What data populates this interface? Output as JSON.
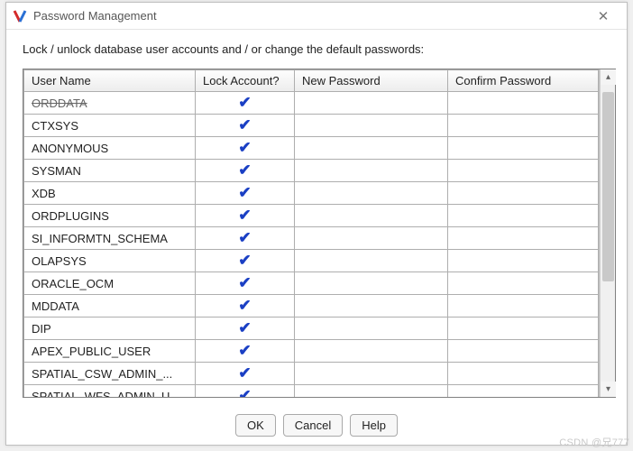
{
  "window": {
    "title": "Password Management",
    "close_glyph": "✕"
  },
  "instruction": "Lock / unlock database user accounts and / or change the default passwords:",
  "columns": {
    "user": "User Name",
    "lock": "Lock Account?",
    "newpw": "New Password",
    "confpw": "Confirm Password"
  },
  "rows": [
    {
      "user": "ORDDATA",
      "locked": true,
      "newpw": "",
      "confpw": ""
    },
    {
      "user": "CTXSYS",
      "locked": true,
      "newpw": "",
      "confpw": ""
    },
    {
      "user": "ANONYMOUS",
      "locked": true,
      "newpw": "",
      "confpw": ""
    },
    {
      "user": "SYSMAN",
      "locked": true,
      "newpw": "",
      "confpw": ""
    },
    {
      "user": "XDB",
      "locked": true,
      "newpw": "",
      "confpw": ""
    },
    {
      "user": "ORDPLUGINS",
      "locked": true,
      "newpw": "",
      "confpw": ""
    },
    {
      "user": "SI_INFORMTN_SCHEMA",
      "locked": true,
      "newpw": "",
      "confpw": ""
    },
    {
      "user": "OLAPSYS",
      "locked": true,
      "newpw": "",
      "confpw": ""
    },
    {
      "user": "ORACLE_OCM",
      "locked": true,
      "newpw": "",
      "confpw": ""
    },
    {
      "user": "MDDATA",
      "locked": true,
      "newpw": "",
      "confpw": ""
    },
    {
      "user": "DIP",
      "locked": true,
      "newpw": "",
      "confpw": ""
    },
    {
      "user": "APEX_PUBLIC_USER",
      "locked": true,
      "newpw": "",
      "confpw": ""
    },
    {
      "user": "SPATIAL_CSW_ADMIN_...",
      "locked": true,
      "newpw": "",
      "confpw": ""
    },
    {
      "user": "SPATIAL_WFS_ADMIN_U...",
      "locked": true,
      "newpw": "",
      "confpw": ""
    }
  ],
  "buttons": {
    "ok": "OK",
    "cancel": "Cancel",
    "help": "Help"
  },
  "scroll": {
    "up_glyph": "▴",
    "down_glyph": "▾"
  },
  "watermark": "CSDN @兄777"
}
